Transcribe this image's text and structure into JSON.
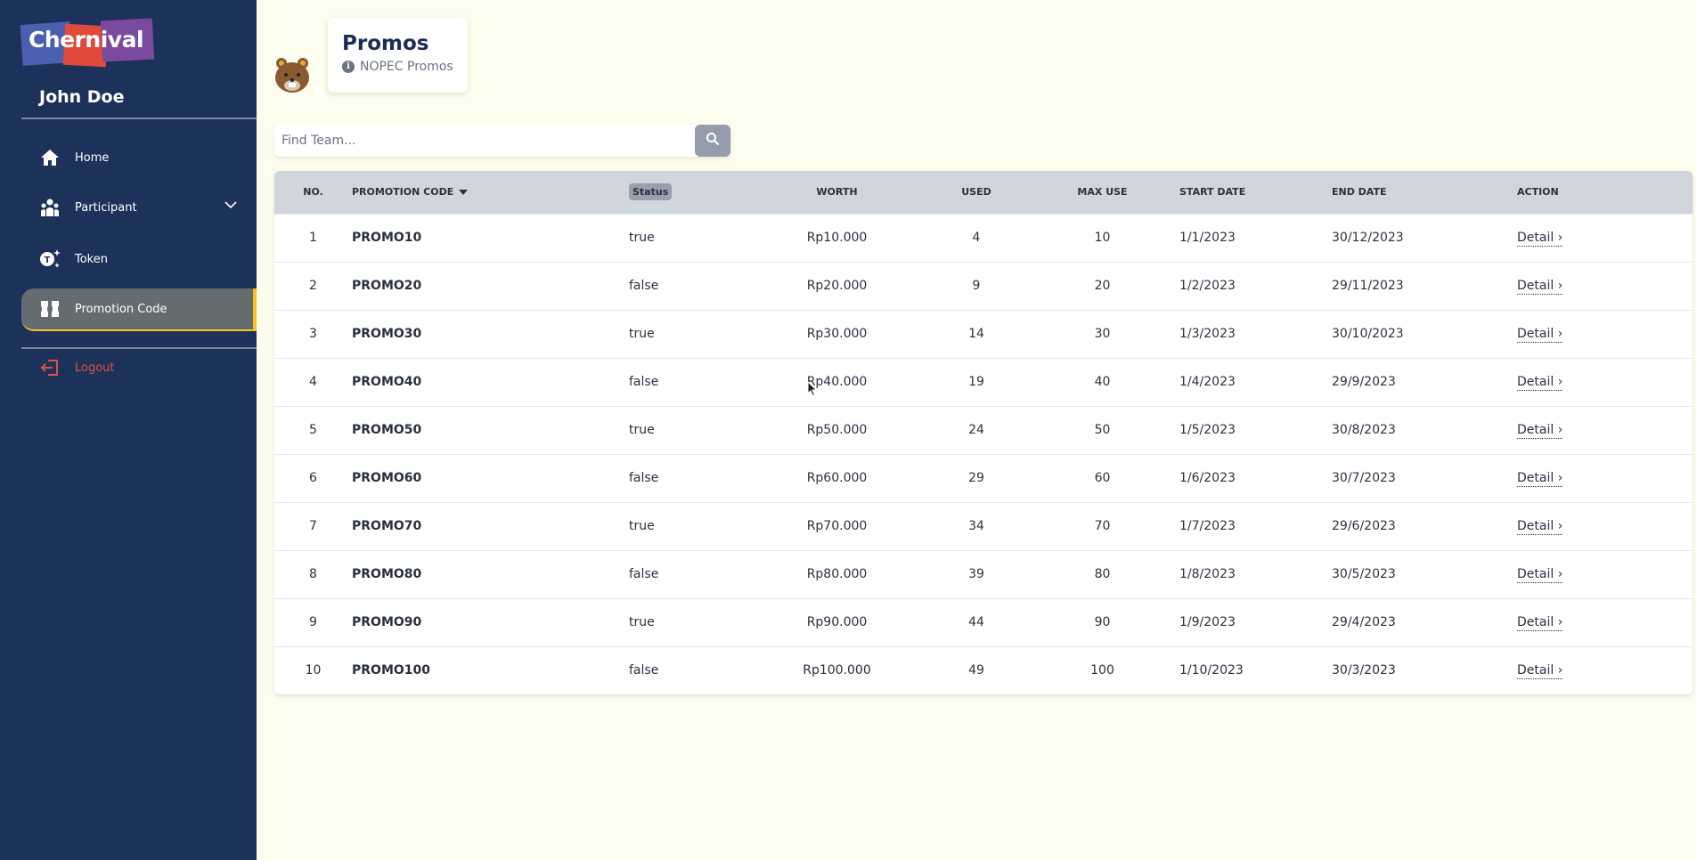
{
  "sidebar": {
    "logo_text": "Chernival",
    "user_name": "John Doe",
    "items": [
      {
        "label": "Home",
        "icon": "home-icon"
      },
      {
        "label": "Participant",
        "icon": "users-icon",
        "expandable": true
      },
      {
        "label": "Token",
        "icon": "token-icon"
      },
      {
        "label": "Promotion Code",
        "icon": "ticket-icon",
        "active": true
      }
    ],
    "logout_label": "Logout"
  },
  "header": {
    "title": "Promos",
    "subtitle": "NOPEC Promos"
  },
  "search": {
    "placeholder": "Find Team...",
    "value": ""
  },
  "table": {
    "columns": {
      "no": "NO.",
      "code": "PROMOTION CODE",
      "status": "Status",
      "worth": "WORTH",
      "used": "USED",
      "max_use": "MAX USE",
      "start_date": "START DATE",
      "end_date": "END DATE",
      "action": "ACTION"
    },
    "rows": [
      {
        "no": "1",
        "code": "PROMO10",
        "status": "true",
        "worth": "Rp10.000",
        "used": "4",
        "max_use": "10",
        "start_date": "1/1/2023",
        "end_date": "30/12/2023",
        "action": "Detail ›"
      },
      {
        "no": "2",
        "code": "PROMO20",
        "status": "false",
        "worth": "Rp20.000",
        "used": "9",
        "max_use": "20",
        "start_date": "1/2/2023",
        "end_date": "29/11/2023",
        "action": "Detail ›"
      },
      {
        "no": "3",
        "code": "PROMO30",
        "status": "true",
        "worth": "Rp30.000",
        "used": "14",
        "max_use": "30",
        "start_date": "1/3/2023",
        "end_date": "30/10/2023",
        "action": "Detail ›"
      },
      {
        "no": "4",
        "code": "PROMO40",
        "status": "false",
        "worth": "Rp40.000",
        "used": "19",
        "max_use": "40",
        "start_date": "1/4/2023",
        "end_date": "29/9/2023",
        "action": "Detail ›"
      },
      {
        "no": "5",
        "code": "PROMO50",
        "status": "true",
        "worth": "Rp50.000",
        "used": "24",
        "max_use": "50",
        "start_date": "1/5/2023",
        "end_date": "30/8/2023",
        "action": "Detail ›"
      },
      {
        "no": "6",
        "code": "PROMO60",
        "status": "false",
        "worth": "Rp60.000",
        "used": "29",
        "max_use": "60",
        "start_date": "1/6/2023",
        "end_date": "30/7/2023",
        "action": "Detail ›"
      },
      {
        "no": "7",
        "code": "PROMO70",
        "status": "true",
        "worth": "Rp70.000",
        "used": "34",
        "max_use": "70",
        "start_date": "1/7/2023",
        "end_date": "29/6/2023",
        "action": "Detail ›"
      },
      {
        "no": "8",
        "code": "PROMO80",
        "status": "false",
        "worth": "Rp80.000",
        "used": "39",
        "max_use": "80",
        "start_date": "1/8/2023",
        "end_date": "30/5/2023",
        "action": "Detail ›"
      },
      {
        "no": "9",
        "code": "PROMO90",
        "status": "true",
        "worth": "Rp90.000",
        "used": "44",
        "max_use": "90",
        "start_date": "1/9/2023",
        "end_date": "29/4/2023",
        "action": "Detail ›"
      },
      {
        "no": "10",
        "code": "PROMO100",
        "status": "false",
        "worth": "Rp100.000",
        "used": "49",
        "max_use": "100",
        "start_date": "1/10/2023",
        "end_date": "30/3/2023",
        "action": "Detail ›"
      }
    ]
  },
  "colors": {
    "sidebar_bg": "#1c325a",
    "page_bg": "#fdfdef",
    "active_accent": "#f7c21c",
    "logout": "#e0503d",
    "title": "#1c2d57",
    "table_header_bg": "#d1d5dc"
  }
}
